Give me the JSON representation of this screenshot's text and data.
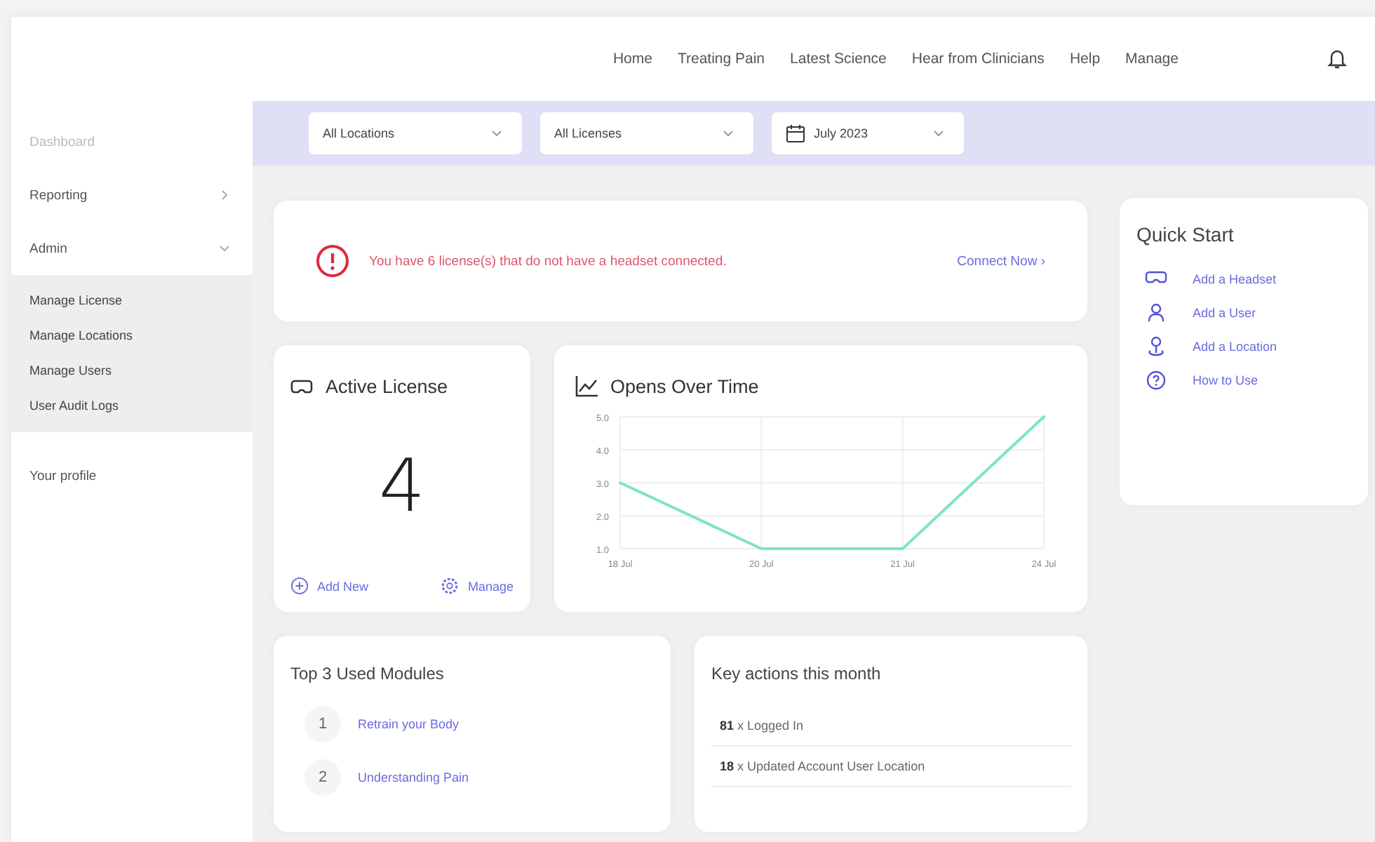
{
  "nav": [
    "Home",
    "Treating Pain",
    "Latest Science",
    "Hear from Clinicians",
    "Help",
    "Manage"
  ],
  "sidebar": {
    "items": [
      {
        "label": "Dashboard",
        "disabled": true
      },
      {
        "label": "Reporting",
        "disabled": false,
        "expanded": false
      },
      {
        "label": "Admin",
        "disabled": false,
        "expanded": true,
        "children": [
          {
            "label": "Manage License"
          },
          {
            "label": "Manage Locations"
          },
          {
            "label": "Manage Users"
          },
          {
            "label": "User Audit Logs"
          }
        ]
      },
      {
        "label": "Your profile",
        "disabled": false
      }
    ]
  },
  "filters": [
    {
      "value": "All Locations",
      "kind": "plain"
    },
    {
      "value": "All Licenses",
      "kind": "plain"
    },
    {
      "value": "July 2023",
      "kind": "date"
    }
  ],
  "alert": {
    "message": "You have 6 license(s) that do not have a headset connected.",
    "action": "Connect Now ›"
  },
  "active_license": {
    "title": "Active License",
    "count": "4",
    "add": "Add New",
    "manage": "Manage"
  },
  "opens": {
    "title": "Opens Over Time",
    "chart_data": {
      "type": "line",
      "categories": [
        "18 Jul",
        "20 Jul",
        "21 Jul",
        "24 Jul"
      ],
      "series": [
        {
          "color": "#7fe3c9",
          "values": [
            3,
            1,
            1,
            5
          ]
        }
      ],
      "grid": true,
      "ylim": [
        1,
        5
      ],
      "yticks": [
        {
          "value": 1,
          "label": "1.0"
        },
        {
          "value": 2,
          "label": "2.0"
        },
        {
          "value": 3,
          "label": "3.0"
        },
        {
          "value": 4,
          "label": "4.0"
        },
        {
          "value": 5,
          "label": "5.0"
        }
      ]
    }
  },
  "quick_start": {
    "title": "Quick Start",
    "items": [
      {
        "label": "Add a Headset",
        "kind": "headset"
      },
      {
        "label": "Add a User",
        "kind": "user"
      },
      {
        "label": "Add a Location",
        "kind": "location"
      },
      {
        "label": "How to Use",
        "kind": "help"
      }
    ]
  },
  "top_modules": {
    "title": "Top 3 Used Modules",
    "items": [
      {
        "rank": "1",
        "label": "Retrain your Body"
      },
      {
        "rank": "2",
        "label": "Understanding Pain"
      }
    ]
  },
  "key_actions": {
    "title": "Key actions this month",
    "items": [
      "**81** x Logged In",
      "**18** x Updated Account User Location"
    ]
  }
}
